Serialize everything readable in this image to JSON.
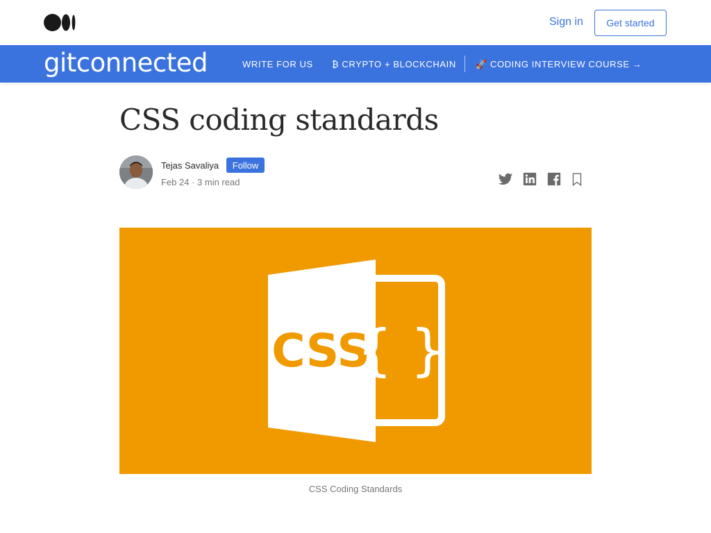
{
  "header": {
    "logo_icon": "medium-logo-icon",
    "sign_in_label": "Sign in",
    "get_started_label": "Get started"
  },
  "publication": {
    "name": "gitconnected",
    "accent_color": "#3b73de",
    "nav": [
      {
        "label": "WRITE FOR US"
      },
      {
        "label": "₿ CRYPTO + BLOCKCHAIN"
      },
      {
        "label": "🚀 CODING INTERVIEW COURSE →"
      }
    ]
  },
  "article": {
    "title": "CSS coding standards",
    "author": "Tejas Savaliya",
    "follow_label": "Follow",
    "meta": "Feb 24 · 3 min read",
    "share_icons": [
      "twitter-icon",
      "linkedin-icon",
      "facebook-icon",
      "bookmark-icon"
    ],
    "hero": {
      "text": "CSS",
      "braces": "{ }",
      "background_color": "#f09a00"
    },
    "caption": "CSS Coding Standards"
  }
}
